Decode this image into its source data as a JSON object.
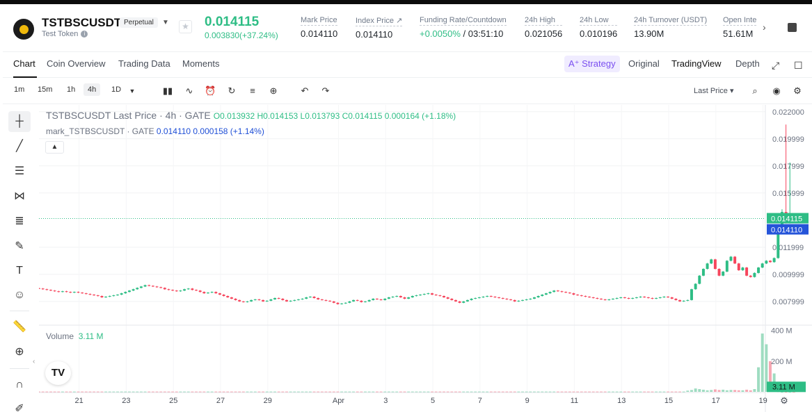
{
  "header": {
    "symbol": "TSTBSCUSDT",
    "badge": "Perpetual",
    "token_name": "Test Token",
    "price": "0.014115",
    "change": "0.003830(+37.24%)",
    "stats": [
      {
        "label": "Mark Price",
        "value": "0.014110"
      },
      {
        "label": "Index Price ↗",
        "value": "0.014110"
      },
      {
        "label": "Funding Rate/Countdown",
        "value_green": "+0.0050%",
        "value": " / 03:51:10"
      },
      {
        "label": "24h High",
        "value": "0.021056"
      },
      {
        "label": "24h Low",
        "value": "0.010196"
      },
      {
        "label": "24h Turnover (USDT)",
        "value": "13.90M"
      },
      {
        "label": "Open Inte",
        "value": "51.61M"
      }
    ]
  },
  "tabs": {
    "chart": "Chart",
    "coin_overview": "Coin Overview",
    "trading_data": "Trading Data",
    "moments": "Moments",
    "strategy": "Strategy",
    "original": "Original",
    "tradingview": "TradingView",
    "depth": "Depth"
  },
  "toolbar": {
    "timeframes": [
      "1m",
      "15m",
      "1h",
      "4h",
      "1D"
    ],
    "active_timeframe": "4h",
    "price_type": "Last Price"
  },
  "legend": {
    "title": "TSTBSCUSDT Last Price · 4h · GATE",
    "ohlc": "O0.013932  H0.014153  L0.013793  C0.014115  0.000164 (+1.18%)",
    "mark_label": "mark_TSTBSCUSDT · GATE",
    "mark_values": "0.014110  0.000158 (+1.14%)",
    "volume_label": "Volume",
    "volume_value": "3.11 M"
  },
  "colors": {
    "up": "#2ebd85",
    "down": "#f6465d",
    "mark": "#2554d9",
    "accent": "#7a4ff0"
  },
  "chart_data": {
    "type": "candlestick",
    "price_axis_labels": [
      "0.022000",
      "0.019999",
      "0.017999",
      "0.015999",
      "0.011999",
      "0.009999",
      "0.007999"
    ],
    "price_ylim": [
      0.0063,
      0.0225
    ],
    "last_price_label": "0.014115",
    "mark_price_label": "0.014110",
    "volume_axis_labels": [
      "400 M",
      "200 M"
    ],
    "volume_last_label": "3.11 M",
    "x_labels": [
      "21",
      "23",
      "25",
      "27",
      "29",
      "Apr",
      "3",
      "5",
      "7",
      "9",
      "11",
      "13",
      "15",
      "17",
      "19"
    ],
    "x_label_days": [
      -11,
      -9,
      -7,
      -5,
      -3,
      0,
      2,
      4,
      6,
      8,
      10,
      12,
      14,
      16,
      18
    ],
    "x_range_days": [
      -12.7,
      18.1
    ],
    "candle_start_day": -12.7,
    "candle_step_days": 0.1667,
    "closes": [
      0.00895,
      0.0089,
      0.00885,
      0.0088,
      0.00875,
      0.0087,
      0.00875,
      0.0087,
      0.00865,
      0.0087,
      0.00865,
      0.0086,
      0.00855,
      0.0085,
      0.00845,
      0.0084,
      0.0083,
      0.00835,
      0.0084,
      0.00845,
      0.0085,
      0.0086,
      0.0087,
      0.0088,
      0.0089,
      0.009,
      0.0091,
      0.0092,
      0.00915,
      0.0091,
      0.00905,
      0.009,
      0.0089,
      0.00885,
      0.0088,
      0.00875,
      0.0088,
      0.0089,
      0.00895,
      0.00885,
      0.0088,
      0.0087,
      0.0086,
      0.00865,
      0.0087,
      0.0086,
      0.0085,
      0.0084,
      0.0083,
      0.0082,
      0.0081,
      0.008,
      0.00795,
      0.008,
      0.0081,
      0.00815,
      0.0081,
      0.008,
      0.00805,
      0.00815,
      0.00825,
      0.0082,
      0.0081,
      0.008,
      0.00805,
      0.0081,
      0.00815,
      0.0082,
      0.0083,
      0.00835,
      0.00825,
      0.00815,
      0.0081,
      0.00805,
      0.008,
      0.0079,
      0.0078,
      0.00785,
      0.0079,
      0.008,
      0.0081,
      0.00805,
      0.00795,
      0.008,
      0.0081,
      0.0082,
      0.00815,
      0.0081,
      0.0082,
      0.0083,
      0.00835,
      0.0084,
      0.0083,
      0.0082,
      0.0083,
      0.0084,
      0.00845,
      0.0085,
      0.00855,
      0.0086,
      0.0085,
      0.00845,
      0.0084,
      0.0083,
      0.0082,
      0.0081,
      0.008,
      0.0079,
      0.008,
      0.0081,
      0.0082,
      0.00825,
      0.0083,
      0.00835,
      0.0084,
      0.00835,
      0.0083,
      0.00825,
      0.0082,
      0.00815,
      0.0081,
      0.008,
      0.00805,
      0.0081,
      0.00815,
      0.0082,
      0.0083,
      0.0084,
      0.0085,
      0.0086,
      0.0087,
      0.0088,
      0.00875,
      0.0087,
      0.00865,
      0.0086,
      0.0085,
      0.00845,
      0.0084,
      0.00835,
      0.0083,
      0.00825,
      0.0082,
      0.00815,
      0.0081,
      0.00815,
      0.0082,
      0.00825,
      0.0083,
      0.00825,
      0.0082,
      0.00825,
      0.0083,
      0.00835,
      0.0083,
      0.00825,
      0.0082,
      0.00825,
      0.0083,
      0.00835,
      0.0083,
      0.0082,
      0.0081,
      0.008,
      0.00805,
      0.0081,
      0.0089,
      0.0093,
      0.0099,
      0.0104,
      0.0108,
      0.0111,
      0.0104,
      0.0099,
      0.0102,
      0.011,
      0.0113,
      0.0108,
      0.0103,
      0.0105,
      0.0099,
      0.0098,
      0.0101,
      0.0105,
      0.0108,
      0.011,
      0.0109,
      0.0112,
      0.013,
      0.0146,
      0.0138,
      0.0142,
      0.01411
    ],
    "volumes_m": [
      2,
      2,
      2,
      2,
      2,
      2,
      2,
      2,
      2,
      2,
      2,
      2,
      2,
      2,
      2,
      2,
      2,
      2,
      2,
      2,
      2,
      2,
      2,
      2,
      2,
      2,
      2,
      2,
      2,
      2,
      2,
      2,
      2,
      2,
      2,
      2,
      2,
      2,
      2,
      2,
      2,
      2,
      2,
      2,
      2,
      2,
      2,
      2,
      2,
      2,
      2,
      2,
      2,
      2,
      2,
      2,
      2,
      2,
      2,
      2,
      2,
      2,
      2,
      2,
      2,
      2,
      2,
      2,
      2,
      2,
      2,
      2,
      2,
      2,
      2,
      2,
      2,
      2,
      2,
      2,
      2,
      2,
      2,
      2,
      2,
      2,
      2,
      2,
      2,
      2,
      2,
      2,
      2,
      2,
      2,
      2,
      2,
      2,
      2,
      2,
      2,
      2,
      2,
      2,
      2,
      2,
      2,
      2,
      2,
      2,
      2,
      2,
      2,
      2,
      2,
      2,
      2,
      2,
      2,
      2,
      2,
      2,
      2,
      2,
      2,
      2,
      2,
      2,
      2,
      2,
      2,
      2,
      2,
      2,
      2,
      2,
      2,
      2,
      2,
      2,
      2,
      2,
      2,
      2,
      2,
      2,
      2,
      2,
      2,
      2,
      2,
      2,
      2,
      2,
      2,
      2,
      2,
      2,
      2,
      2,
      2,
      2,
      2,
      2,
      2,
      8,
      12,
      22,
      18,
      14,
      10,
      12,
      16,
      12,
      14,
      10,
      12,
      12,
      10,
      10,
      14,
      10,
      18,
      160,
      380,
      310,
      200,
      120,
      3.11
    ],
    "volume_ylim": [
      0,
      430
    ]
  }
}
